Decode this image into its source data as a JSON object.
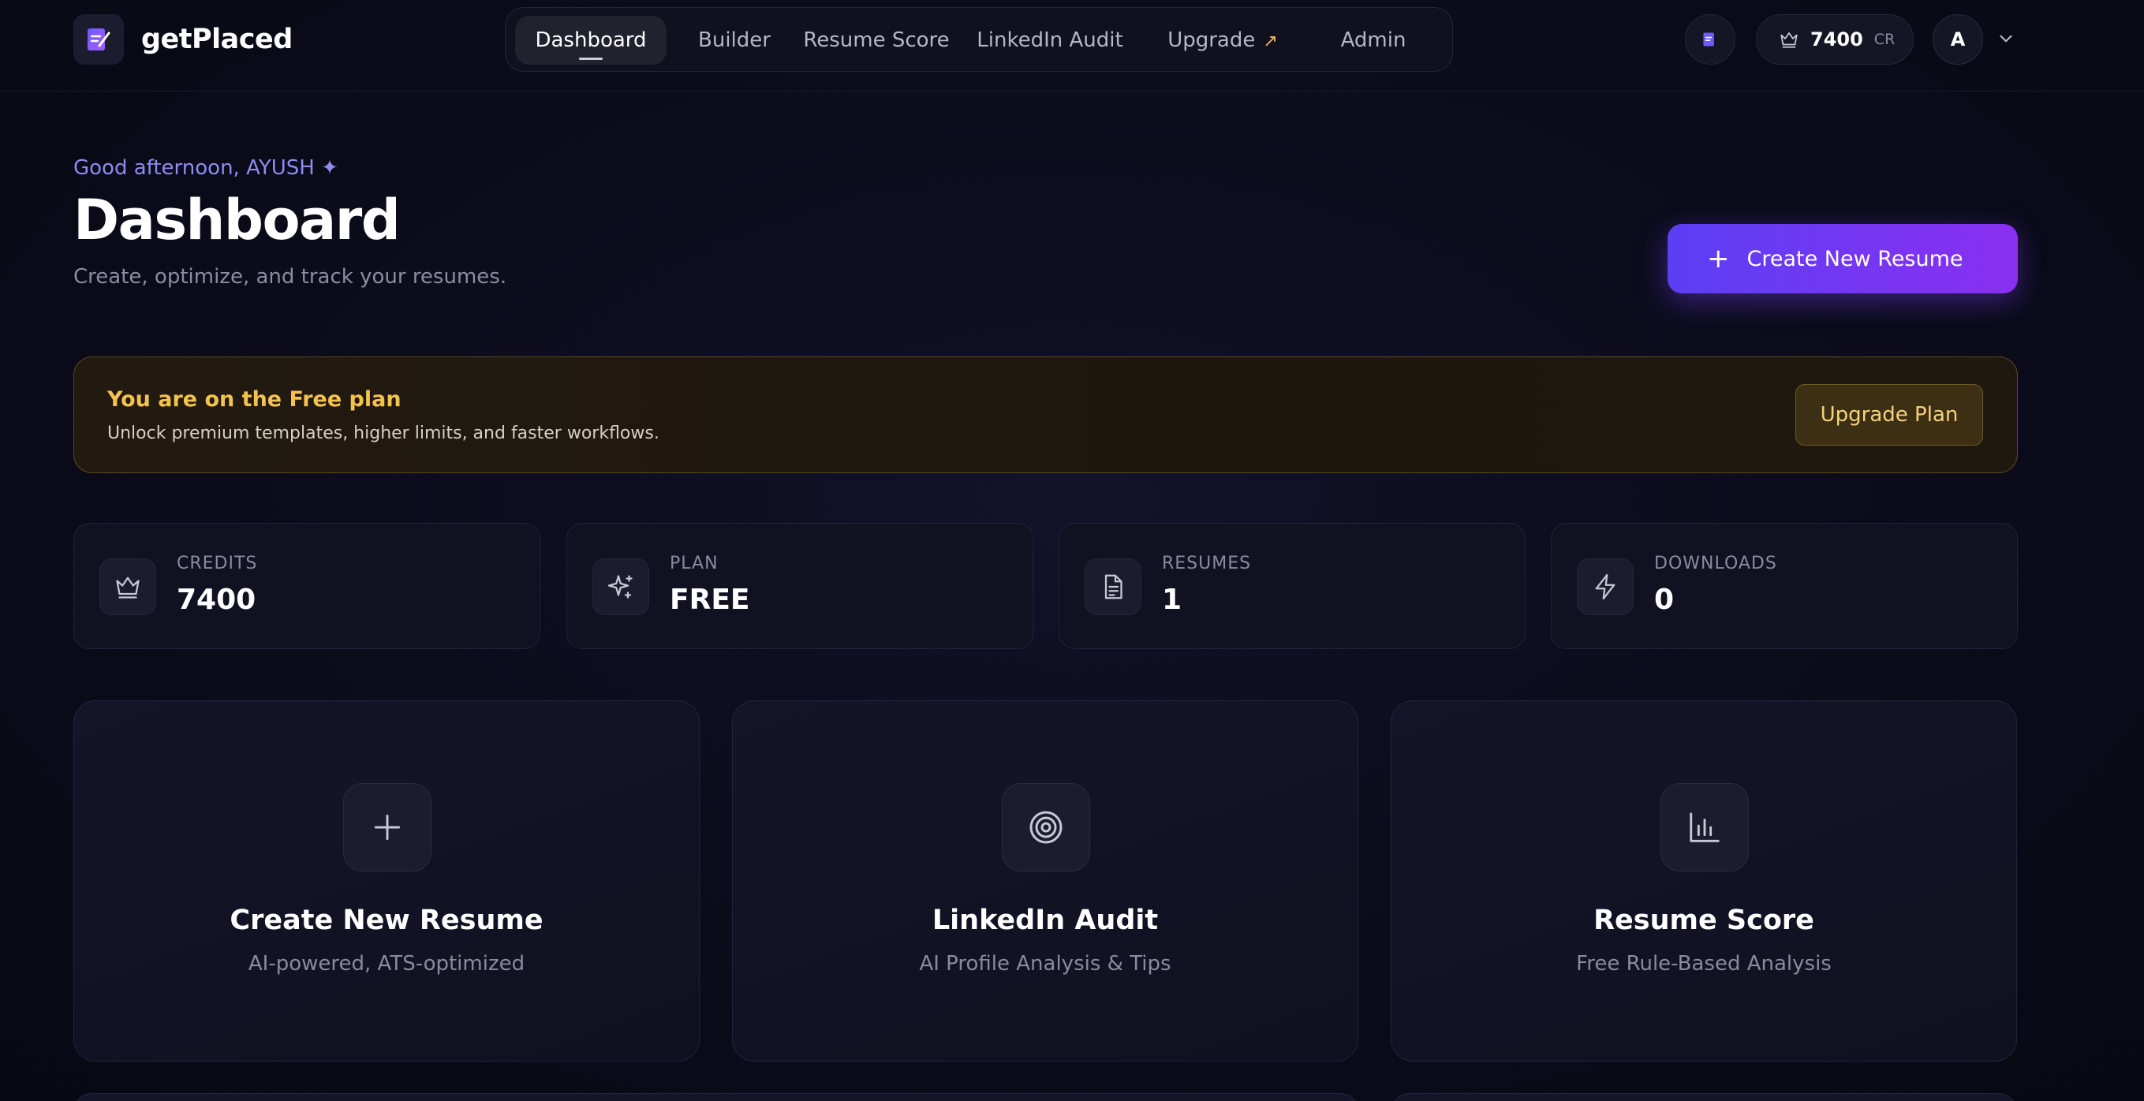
{
  "brand": {
    "name": "getPlaced"
  },
  "nav": {
    "items": [
      {
        "label": "Dashboard"
      },
      {
        "label": "Builder"
      },
      {
        "label": "Resume Score"
      },
      {
        "label": "LinkedIn Audit"
      },
      {
        "label": "Upgrade"
      },
      {
        "label": "Admin"
      }
    ],
    "active_index": 0
  },
  "account": {
    "credits": "7400",
    "credits_unit": "CR",
    "avatar_initial": "A"
  },
  "header": {
    "greeting": "Good afternoon, AYUSH ✦",
    "title": "Dashboard",
    "subtitle": "Create, optimize, and track your resumes.",
    "cta_label": "Create New Resume"
  },
  "banner": {
    "title": "You are on the Free plan",
    "description": "Unlock premium templates, higher limits, and faster workflows.",
    "button_label": "Upgrade Plan"
  },
  "stats": [
    {
      "label": "CREDITS",
      "value": "7400",
      "icon": "crown-icon"
    },
    {
      "label": "PLAN",
      "value": "FREE",
      "icon": "sparkles-icon"
    },
    {
      "label": "RESUMES",
      "value": "1",
      "icon": "document-icon"
    },
    {
      "label": "DOWNLOADS",
      "value": "0",
      "icon": "lightning-icon"
    }
  ],
  "cards": [
    {
      "title": "Create New Resume",
      "subtitle": "AI-powered, ATS-optimized",
      "icon": "plus-icon"
    },
    {
      "title": "LinkedIn Audit",
      "subtitle": "AI Profile Analysis & Tips",
      "icon": "target-icon"
    },
    {
      "title": "Resume Score",
      "subtitle": "Free Rule-Based Analysis",
      "icon": "bar-chart-icon"
    }
  ],
  "colors": {
    "accent_start": "#5b3ff5",
    "accent_end": "#8a2ff0",
    "greeting": "#8d8cf2",
    "banner_title": "#f4c24e",
    "background": "#0b0b1a"
  }
}
